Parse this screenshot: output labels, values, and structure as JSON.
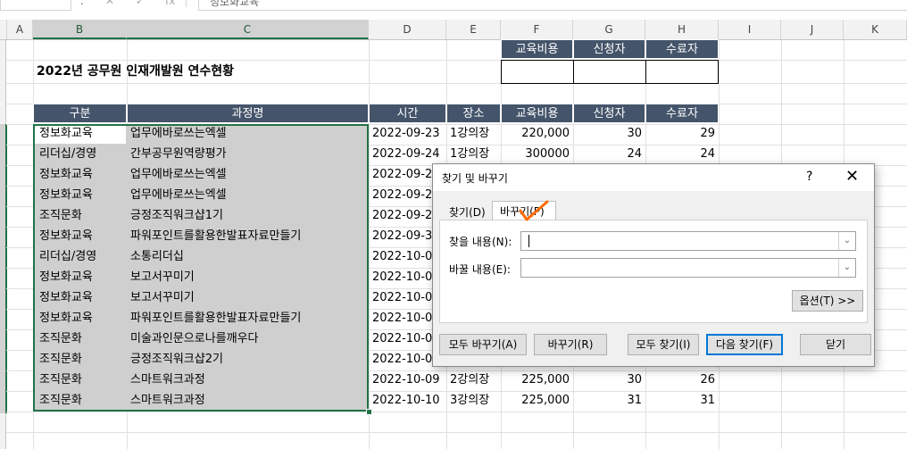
{
  "formula_bar": {
    "namebox": "",
    "dot": ".",
    "icon_cancel": "✕",
    "icon_enter": "✓",
    "icon_fx": "fx",
    "content": "정보화교육"
  },
  "columns": [
    "A",
    "B",
    "C",
    "D",
    "E",
    "F",
    "G",
    "H",
    "I",
    "J",
    "K"
  ],
  "title": "2022년 공무원 인재개발원 연수현황",
  "summary_header": [
    "교육비용",
    "신청자",
    "수료자"
  ],
  "table_header": [
    "구분",
    "과정명",
    "시간",
    "장소",
    "교육비용",
    "신청자",
    "수료자"
  ],
  "rows": [
    [
      "정보화교육",
      "업무에바로쓰는엑셀",
      "2022-09-23",
      "1강의장",
      "220,000",
      "30",
      "29"
    ],
    [
      "리더십/경영",
      "간부공무원역량평가",
      "2022-09-24",
      "1강의장",
      "300000",
      "24",
      "24"
    ],
    [
      "정보화교육",
      "업무에바로쓰는엑셀",
      "2022-09-2",
      "",
      "",
      "",
      ""
    ],
    [
      "정보화교육",
      "업무에바로쓰는엑셀",
      "2022-09-2",
      "",
      "",
      "",
      ""
    ],
    [
      "조직문화",
      "긍정조직워크샵1기",
      "2022-09-2",
      "",
      "",
      "",
      ""
    ],
    [
      "정보화교육",
      "파워포인트를활용한발표자료만들기",
      "2022-09-3",
      "",
      "",
      "",
      ""
    ],
    [
      "리더십/경영",
      "소통리더십",
      "2022-10-0",
      "",
      "",
      "",
      ""
    ],
    [
      "정보화교육",
      "보고서꾸미기",
      "2022-10-0",
      "",
      "",
      "",
      ""
    ],
    [
      "정보화교육",
      "보고서꾸미기",
      "2022-10-0",
      "",
      "",
      "",
      ""
    ],
    [
      "정보화교육",
      "파워포인트를활용한발표자료만들기",
      "2022-10-0",
      "",
      "",
      "",
      ""
    ],
    [
      "조직문화",
      "미술과인문으로나를깨우다",
      "2022-10-0",
      "",
      "",
      "",
      ""
    ],
    [
      "조직문화",
      "긍정조직워크샵2기",
      "2022-10-0",
      "",
      "",
      "",
      ""
    ],
    [
      "조직문화",
      "스마트워크과정",
      "2022-10-09",
      "2강의장",
      "225,000",
      "30",
      "26"
    ],
    [
      "조직문화",
      "스마트워크과정",
      "2022-10-10",
      "3강의장",
      "225,000",
      "31",
      "31"
    ]
  ],
  "dialog": {
    "title": "찾기 및 바꾸기",
    "help": "?",
    "close": "✕",
    "tab_find": "찾기(D)",
    "tab_replace": "바꾸기(P)",
    "find_label": "찾을 내용(N):",
    "replace_label": "바꿀 내용(E):",
    "find_value": "",
    "replace_value": "",
    "options_btn": "옵션(T) >>",
    "btn_replace_all": "모두 바꾸기(A)",
    "btn_replace": "바꾸기(R)",
    "btn_find_all": "모두 찾기(I)",
    "btn_find_next": "다음 찾기(F)",
    "btn_close": "닫기",
    "dropdown_arrow": "⌄"
  },
  "annotation_color": "#ff6a00"
}
